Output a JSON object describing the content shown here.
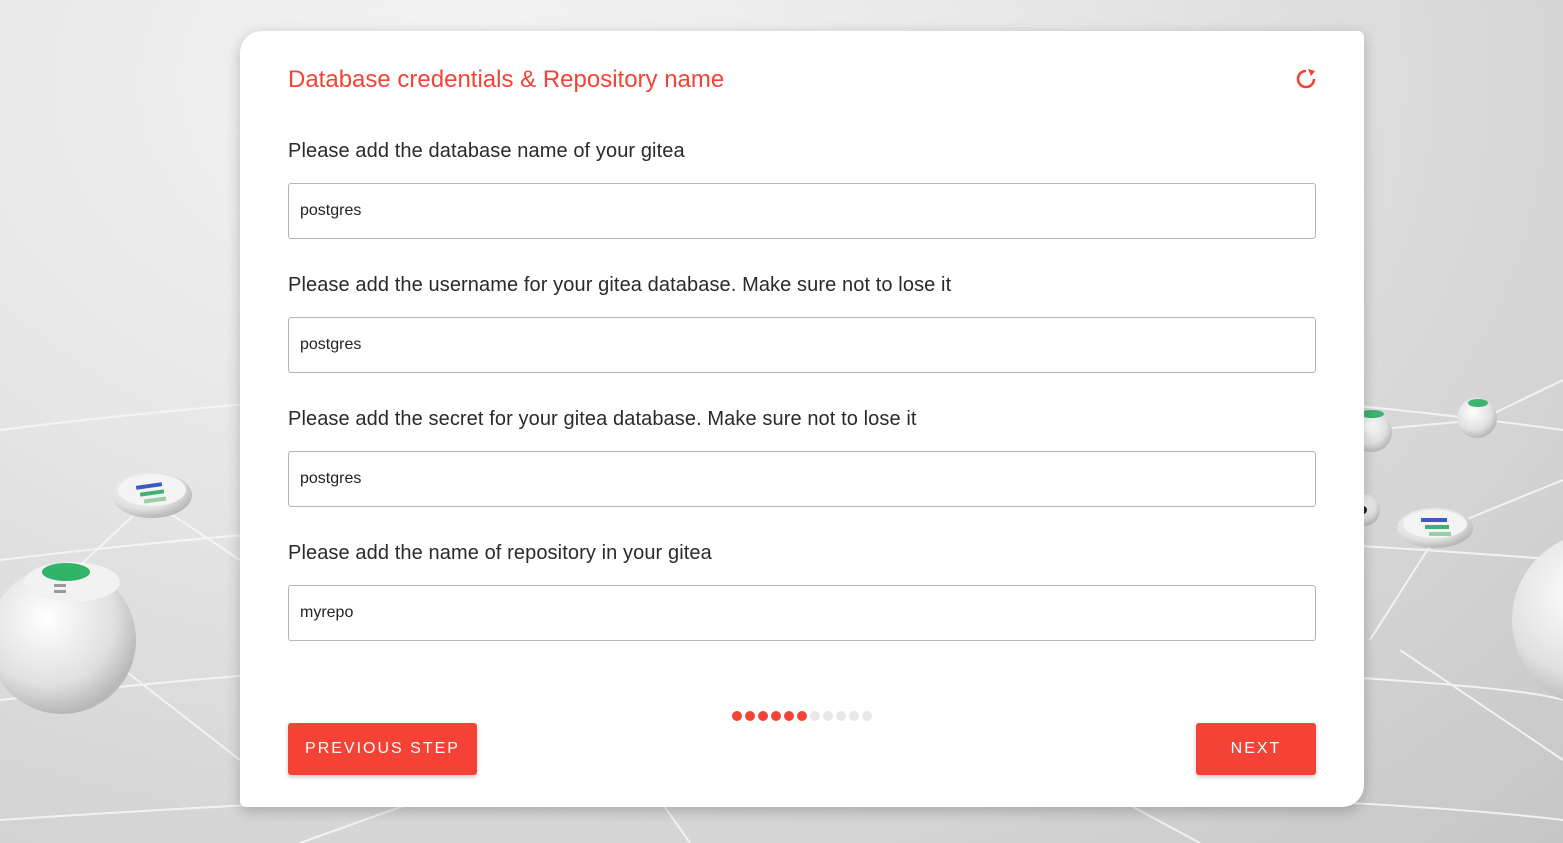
{
  "colors": {
    "accent": "#f44336",
    "dot_inactive": "#e8e8e8"
  },
  "header": {
    "title": "Database credentials & Repository name",
    "refresh_icon": "refresh-icon"
  },
  "fields": [
    {
      "label": "Please add the database name of your gitea",
      "value": "postgres"
    },
    {
      "label": "Please add the username for your gitea database. Make sure not to lose it",
      "value": "postgres"
    },
    {
      "label": "Please add the secret for your gitea database. Make sure not to lose it",
      "value": "postgres"
    },
    {
      "label": "Please add the name of repository in your gitea",
      "value": "myrepo"
    }
  ],
  "progress": {
    "total_steps": 11,
    "completed_steps": 6
  },
  "buttons": {
    "previous": "PREVIOUS STEP",
    "next": "NEXT"
  }
}
